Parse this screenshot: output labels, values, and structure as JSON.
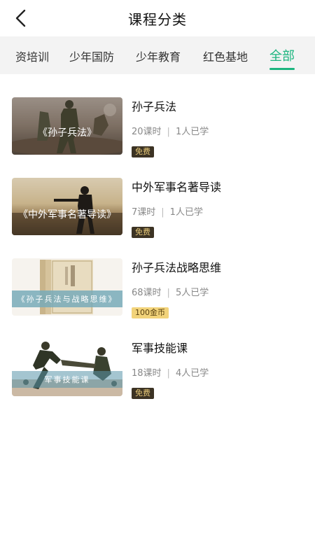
{
  "header": {
    "title": "课程分类",
    "back_icon": "chevron-left-icon"
  },
  "tabs": [
    {
      "label": "资培训",
      "active": false
    },
    {
      "label": "少年国防",
      "active": false
    },
    {
      "label": "少年教育",
      "active": false
    },
    {
      "label": "红色基地",
      "active": false
    },
    {
      "label": "全部",
      "active": true
    }
  ],
  "colors": {
    "accent": "#1cb57f",
    "free_badge_bg": "#3c3324",
    "gold_badge_bg": "#f2d37a"
  },
  "courses": [
    {
      "title": "孙子兵法",
      "thumb_caption": "《孙子兵法》",
      "lessons": "20课时",
      "learners": "1人已学",
      "price": "免费"
    },
    {
      "title": "中外军事名著导读",
      "thumb_caption": "《中外军事名著导读》",
      "lessons": "7课时",
      "learners": "1人已学",
      "price": "免费"
    },
    {
      "title": "孙子兵法战略思维",
      "thumb_caption": "《孙子兵法与战略思维》",
      "lessons": "68课时",
      "learners": "5人已学",
      "price": "100金币"
    },
    {
      "title": "军事技能课",
      "thumb_caption": "军事技能课",
      "lessons": "18课时",
      "learners": "4人已学",
      "price": "免费"
    }
  ]
}
